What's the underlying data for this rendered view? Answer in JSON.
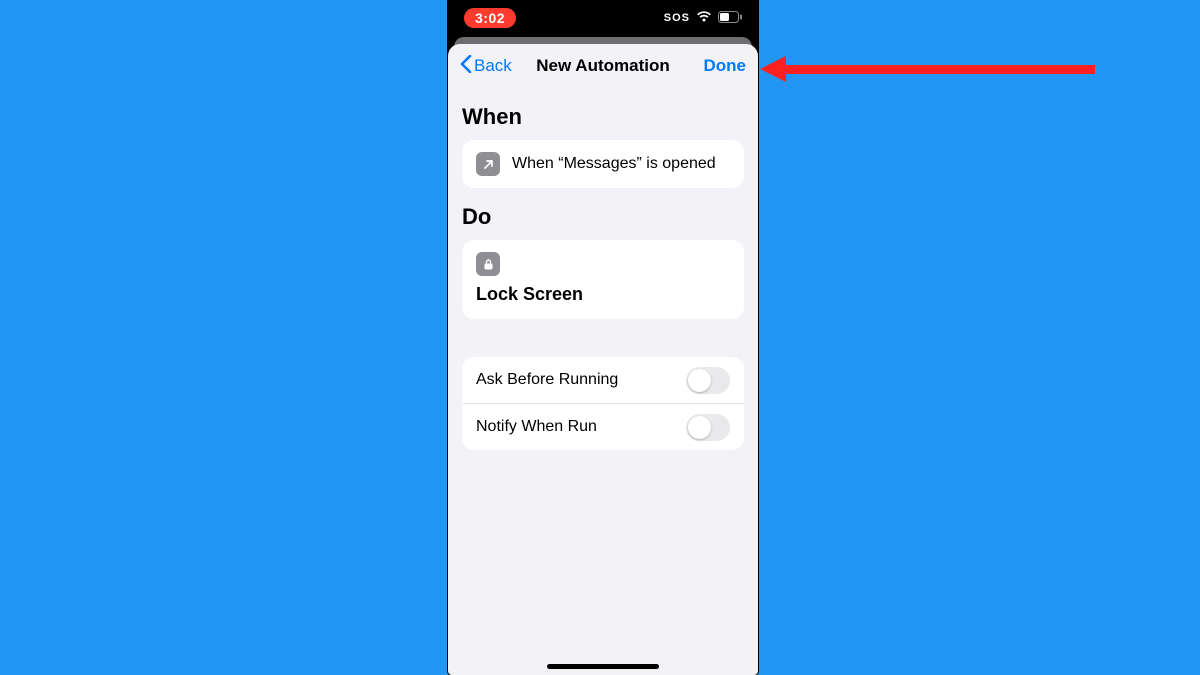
{
  "status": {
    "time": "3:02",
    "sos": "SOS"
  },
  "nav": {
    "back": "Back",
    "title": "New Automation",
    "done": "Done"
  },
  "sections": {
    "when_h": "When",
    "when_text": "When “Messages” is opened",
    "do_h": "Do",
    "do_action": "Lock Screen"
  },
  "settings": {
    "ask": "Ask Before Running",
    "notify": "Notify When Run",
    "ask_on": false,
    "notify_on": false
  }
}
